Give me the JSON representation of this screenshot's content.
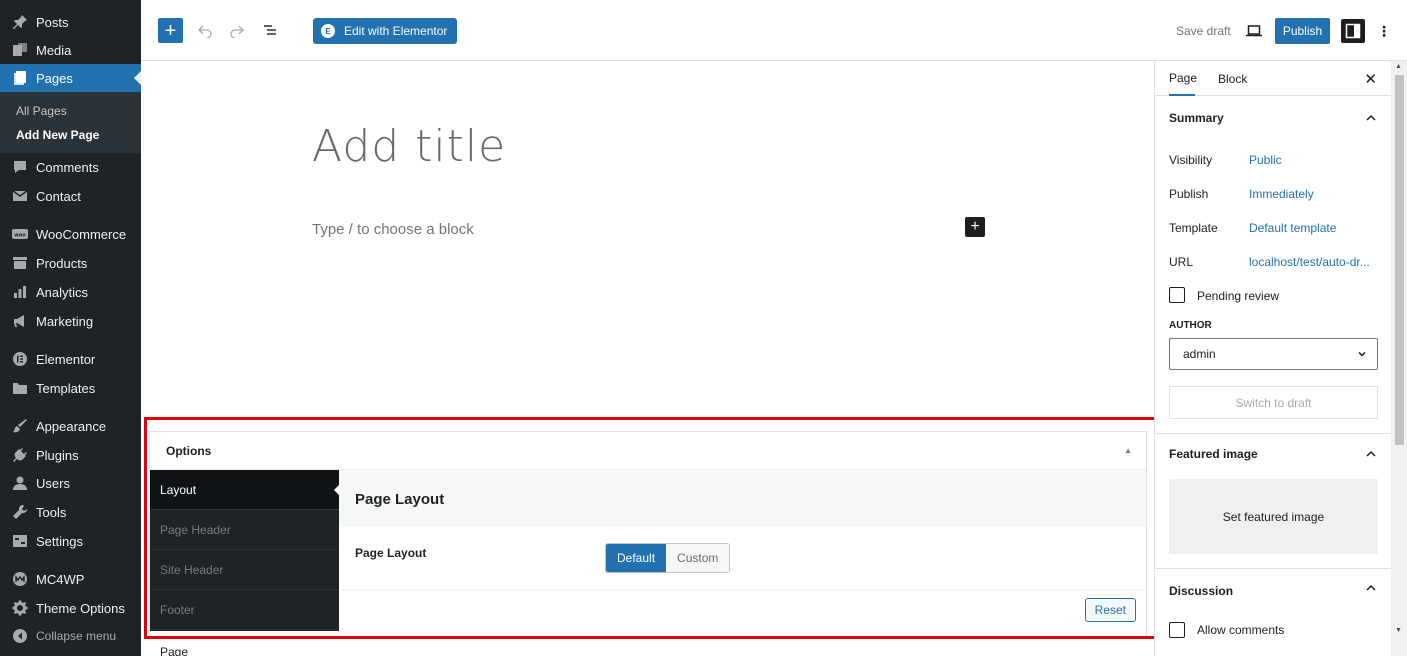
{
  "admin_menu": {
    "items": [
      {
        "key": "posts",
        "label": "Posts",
        "icon": "pin-icon"
      },
      {
        "key": "media",
        "label": "Media",
        "icon": "media-icon"
      },
      {
        "key": "pages",
        "label": "Pages",
        "icon": "pages-icon",
        "current": true
      },
      {
        "key": "comments",
        "label": "Comments",
        "icon": "comment-icon"
      },
      {
        "key": "contact",
        "label": "Contact",
        "icon": "mail-icon"
      },
      {
        "key": "woocommerce",
        "label": "WooCommerce",
        "icon": "woocommerce-icon"
      },
      {
        "key": "products",
        "label": "Products",
        "icon": "archive-icon"
      },
      {
        "key": "analytics",
        "label": "Analytics",
        "icon": "bar-chart-icon"
      },
      {
        "key": "marketing",
        "label": "Marketing",
        "icon": "megaphone-icon"
      },
      {
        "key": "elementor",
        "label": "Elementor",
        "icon": "elementor-icon"
      },
      {
        "key": "templates",
        "label": "Templates",
        "icon": "folder-icon"
      },
      {
        "key": "appearance",
        "label": "Appearance",
        "icon": "brush-icon"
      },
      {
        "key": "plugins",
        "label": "Plugins",
        "icon": "plug-icon"
      },
      {
        "key": "users",
        "label": "Users",
        "icon": "user-icon"
      },
      {
        "key": "tools",
        "label": "Tools",
        "icon": "wrench-icon"
      },
      {
        "key": "settings",
        "label": "Settings",
        "icon": "settings-icon"
      },
      {
        "key": "mc4wp",
        "label": "MC4WP",
        "icon": "mc4wp-icon"
      },
      {
        "key": "theme_options",
        "label": "Theme Options",
        "icon": "gear-icon"
      },
      {
        "key": "collapse",
        "label": "Collapse menu",
        "icon": "collapse-icon"
      }
    ],
    "submenu": [
      {
        "label": "All Pages",
        "current": false
      },
      {
        "label": "Add New Page",
        "current": true
      }
    ]
  },
  "toolbar": {
    "add_block_label": "+",
    "elementor_label": "Edit with Elementor",
    "elementor_icon_text": "E",
    "save_draft_label": "Save draft",
    "publish_label": "Publish",
    "more_label": "⋮"
  },
  "editor": {
    "title_placeholder": "Add title",
    "block_placeholder": "Type / to choose a block",
    "inserter_label": "+"
  },
  "options_box": {
    "title": "Options",
    "tabs": [
      {
        "label": "Layout",
        "active": true
      },
      {
        "label": "Page Header",
        "active": false
      },
      {
        "label": "Site Header",
        "active": false
      },
      {
        "label": "Footer",
        "active": false
      }
    ],
    "panel_title": "Page Layout",
    "field_label": "Page Layout",
    "segments": [
      {
        "label": "Default",
        "active": true
      },
      {
        "label": "Custom",
        "active": false
      }
    ],
    "reset_label": "Reset"
  },
  "breadcrumb": "Page",
  "settings_sidebar": {
    "tabs": [
      {
        "label": "Page",
        "active": true
      },
      {
        "label": "Block",
        "active": false
      }
    ],
    "close_label": "✕",
    "summary": {
      "title": "Summary",
      "rows": [
        {
          "label": "Visibility",
          "value": "Public"
        },
        {
          "label": "Publish",
          "value": "Immediately"
        },
        {
          "label": "Template",
          "value": "Default template"
        },
        {
          "label": "URL",
          "value": "localhost/test/auto-dr..."
        }
      ],
      "pending_review_label": "Pending review",
      "author_label": "AUTHOR",
      "author_value": "admin",
      "switch_to_draft_label": "Switch to draft"
    },
    "featured_image": {
      "title": "Featured image",
      "set_label": "Set featured image"
    },
    "discussion": {
      "title": "Discussion",
      "allow_comments_label": "Allow comments"
    }
  },
  "colors": {
    "admin_bg": "#1d2327",
    "accent": "#2271b1",
    "highlight": "#e0000b"
  }
}
